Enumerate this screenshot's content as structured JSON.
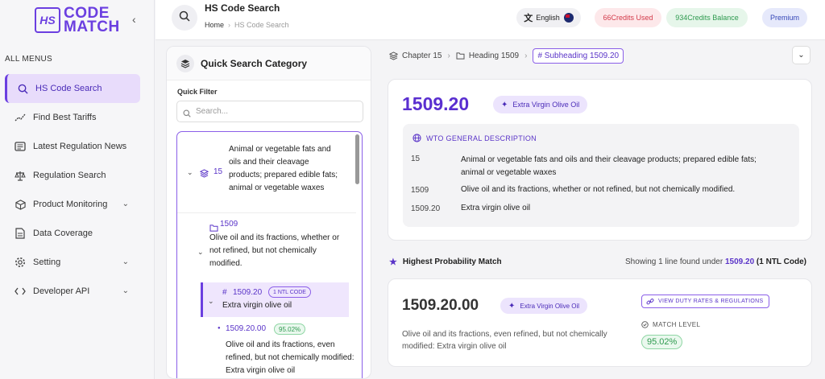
{
  "brand": {
    "logo_mark": "HS",
    "logo_line1": "CODE",
    "logo_line2": "MATCH"
  },
  "sidebar": {
    "collapse_icon": "chevron-left-icon",
    "section_title": "ALL MENUS",
    "items": [
      {
        "label": "HS Code Search",
        "icon": "search-icon",
        "active": true
      },
      {
        "label": "Find Best Tariffs",
        "icon": "trend-line-icon"
      },
      {
        "label": "Latest Regulation News",
        "icon": "newspaper-icon"
      },
      {
        "label": "Regulation Search",
        "icon": "scale-icon"
      },
      {
        "label": "Product Monitoring",
        "icon": "box-icon",
        "expandable": true
      },
      {
        "label": "Data Coverage",
        "icon": "document-icon"
      },
      {
        "label": "Setting",
        "icon": "gear-icon",
        "expandable": true
      },
      {
        "label": "Developer API",
        "icon": "code-icon",
        "expandable": true
      }
    ]
  },
  "header": {
    "title": "HS Code Search",
    "breadcrumb_home": "Home",
    "breadcrumb_current": "HS Code Search",
    "language": "English",
    "credits_used": "66Credits Used",
    "credits_balance": "934Credits Balance",
    "plan": "Premium"
  },
  "category_panel": {
    "title": "Quick Search Category",
    "filter_label": "Quick Filter",
    "search_placeholder": "Search...",
    "chapter": {
      "code": "15",
      "desc": "Animal or vegetable fats and oils and their cleavage products; prepared edible fats; animal or vegetable waxes"
    },
    "heading": {
      "code": "1509",
      "desc": "Olive oil and its fractions, whether or not refined, but not chemically modified."
    },
    "subheading": {
      "code": "1509.20",
      "badge": "1 NTL CODE",
      "desc": "Extra virgin olive oil"
    },
    "ntl": {
      "code": "1509.20.00",
      "match": "95.02%",
      "desc": "Olive oil and its fractions, even refined, but not chemically modified: Extra virgin olive oil"
    }
  },
  "breadcrumb_bar": {
    "chapter": "Chapter 15",
    "heading": "Heading 1509",
    "subheading": "# Subheading 1509.20"
  },
  "detail": {
    "code": "1509.20",
    "tag": "Extra Virgin Olive Oil",
    "wto_title": "WTO GENERAL DESCRIPTION",
    "rows": [
      {
        "k": "15",
        "v": "Animal or vegetable fats and oils and their cleavage products; prepared edible fats; animal or vegetable waxes"
      },
      {
        "k": "1509",
        "v": "Olive oil and its fractions, whether or not refined, but not chemically modified."
      },
      {
        "k": "1509.20",
        "v": "Extra virgin olive oil"
      }
    ]
  },
  "match_section": {
    "title": "Highest Probability Match",
    "showing_prefix": "Showing 1 line found under",
    "showing_code": "1509.20",
    "showing_suffix": "(1 NTL Code)"
  },
  "match_card": {
    "code": "1509.20.00",
    "tag": "Extra Virgin Olive Oil",
    "desc": "Olive oil and its fractions, even refined, but not chemically modified: Extra virgin olive oil",
    "view_button": "VIEW DUTY RATES & REGULATIONS",
    "match_label": "MATCH LEVEL",
    "match_value": "95.02%"
  },
  "colors": {
    "accent": "#6b3fe0",
    "success": "#2e9a4f",
    "danger": "#d33a4a"
  }
}
